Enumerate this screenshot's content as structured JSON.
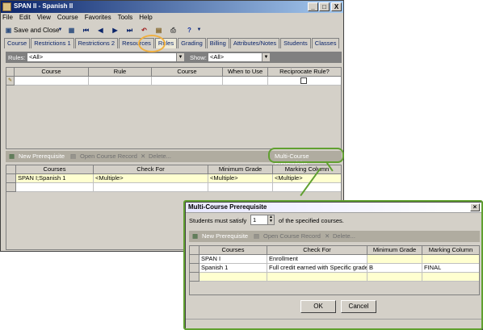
{
  "window": {
    "title": "SPAN II - Spanish II",
    "controls": [
      "_",
      "□",
      "X"
    ]
  },
  "menu": [
    "File",
    "Edit",
    "View",
    "Course",
    "Favorites",
    "Tools",
    "Help"
  ],
  "toolbar": {
    "save_close": "Save and Close",
    "help": "?"
  },
  "tabs": [
    "Course",
    "Restrictions 1",
    "Restrictions 2",
    "Resources",
    "Rules",
    "Grading",
    "Billing",
    "Attributes/Notes",
    "Students",
    "Classes"
  ],
  "active_tab": "Rules",
  "rules_filter": {
    "rules_label": "Rules:",
    "rules_value": "<All>",
    "show_label": "Show:",
    "show_value": "<All>"
  },
  "rules_grid": {
    "headers": [
      "Course",
      "Rule",
      "Course",
      "When to Use",
      "Reciprocate Rule?"
    ]
  },
  "prereq_actions": {
    "new": "New Prerequisite",
    "open": "Open Course Record",
    "delete": "Delete...",
    "multi": "Multi-Course Prerequisite"
  },
  "prereq_grid": {
    "headers": [
      "Courses",
      "Check For",
      "Minimum Grade",
      "Marking Column"
    ],
    "rows": [
      [
        "SPAN I;Spanish 1",
        "<Multiple>",
        "<Multiple>",
        "<Multiple>"
      ]
    ]
  },
  "dialog": {
    "title": "Multi-Course Prerequisite",
    "satisfy_prefix": "Students must satisfy",
    "satisfy_value": "1",
    "satisfy_suffix": "of the specified courses.",
    "actions": {
      "new": "New Prerequisite",
      "open": "Open Course Record",
      "delete": "Delete..."
    },
    "grid": {
      "headers": [
        "Courses",
        "Check For",
        "Minimum Grade",
        "Marking Column"
      ],
      "rows": [
        [
          "SPAN I",
          "Enrollment",
          "",
          ""
        ],
        [
          "Spanish 1",
          "Full credit earned with Specific grade",
          "B",
          "FINAL"
        ]
      ]
    },
    "ok": "OK",
    "cancel": "Cancel"
  }
}
